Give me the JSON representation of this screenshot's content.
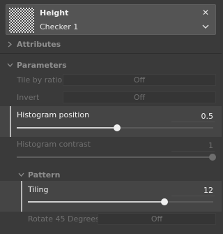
{
  "header": {
    "title": "Height",
    "subtitle": "Checker 1",
    "close_symbol": "✕",
    "icon": "checker-pattern-thumbnail"
  },
  "sections": {
    "attributes": {
      "label": "Attributes",
      "expanded": false
    },
    "parameters": {
      "label": "Parameters",
      "expanded": true
    },
    "pattern": {
      "label": "Pattern",
      "expanded": true
    }
  },
  "params": {
    "tile_by_ratio": {
      "label": "Tile by ratio",
      "value": "Off"
    },
    "invert": {
      "label": "Invert",
      "value": "Off"
    },
    "histogram_position": {
      "label": "Histogram position",
      "value": "0.5",
      "fraction": 0.5
    },
    "histogram_contrast": {
      "label": "Histogram contrast",
      "value": "1",
      "fraction": 1.0
    },
    "tiling": {
      "label": "Tiling",
      "value": "12",
      "fraction": 0.73
    },
    "rotate_45": {
      "label": "Rotate 45 Degrees",
      "value": "Off"
    }
  },
  "colors": {
    "panel_bg": "#3a3a3a",
    "header_bg": "#545454",
    "highlight_bg": "#454545",
    "active_text": "#f2f2f2",
    "disabled_text": "#707070"
  }
}
